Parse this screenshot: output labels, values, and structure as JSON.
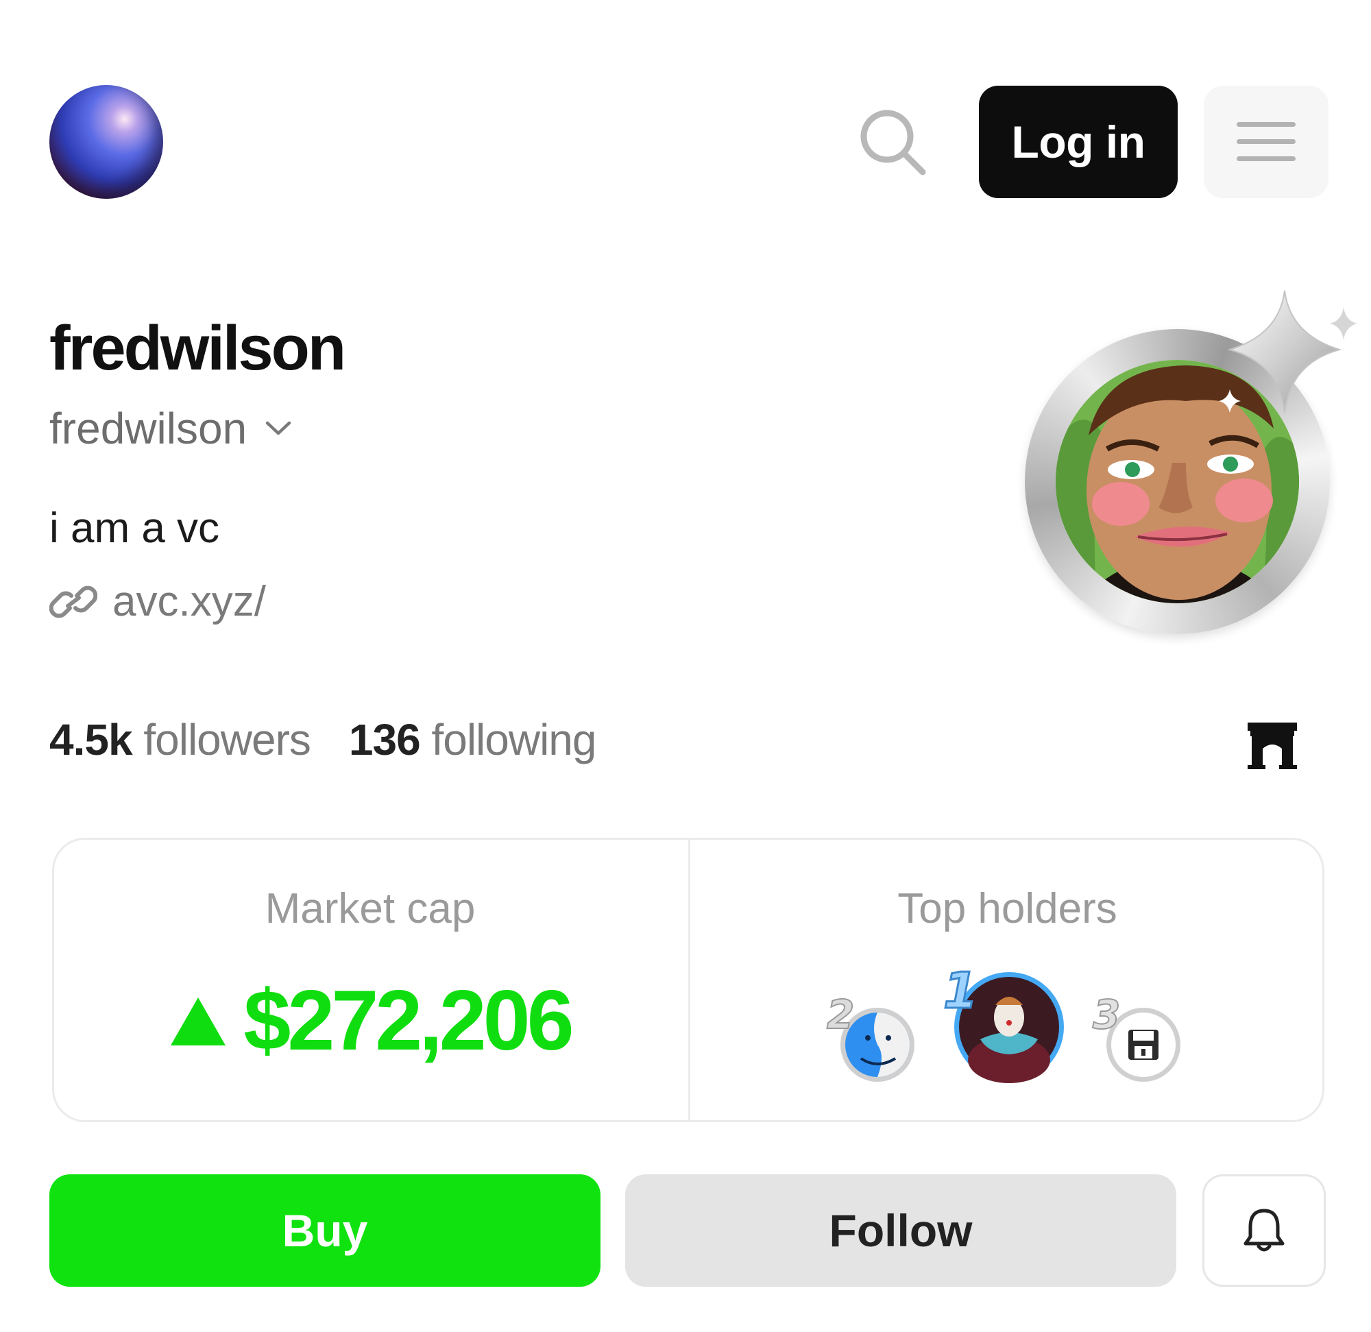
{
  "header": {
    "login_label": "Log in",
    "logo_icon": "orb-logo-icon",
    "search_icon": "search-icon",
    "menu_icon": "hamburger-menu-icon"
  },
  "profile": {
    "display_name": "fredwilson",
    "handle": "fredwilson",
    "bio": "i am a vc",
    "link": "avc.xyz/",
    "avatar_icon": "profile-portrait-avatar"
  },
  "stats": {
    "followers_count": "4.5k",
    "followers_label": "followers",
    "following_count": "136",
    "following_label": "following",
    "badge_icon": "arch-icon"
  },
  "market": {
    "label": "Market cap",
    "value": "$272,206",
    "trend": "up",
    "color": "#10dd10"
  },
  "top_holders": {
    "label": "Top holders",
    "holders": [
      {
        "rank": "2",
        "icon": "finder-face-icon"
      },
      {
        "rank": "1",
        "icon": "clown-portrait-icon"
      },
      {
        "rank": "3",
        "icon": "floppy-disk-icon"
      }
    ]
  },
  "actions": {
    "buy_label": "Buy",
    "follow_label": "Follow",
    "bell_icon": "bell-icon"
  },
  "colors": {
    "accent_green": "#10e210",
    "login_bg": "#0d0d0d"
  }
}
